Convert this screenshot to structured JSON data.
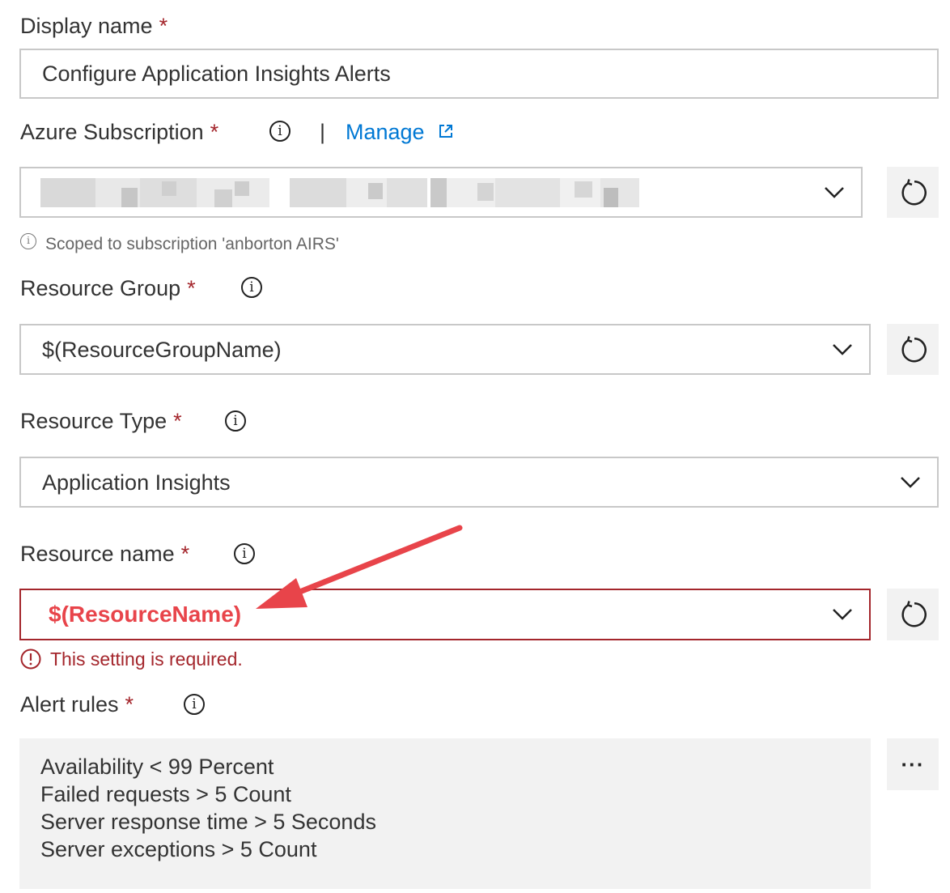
{
  "required_marker": "*",
  "info_glyph": "i",
  "display_name": {
    "label": "Display name",
    "value": "Configure Application Insights Alerts"
  },
  "azure_subscription": {
    "label": "Azure Subscription",
    "separator": "|",
    "manage_link": "Manage",
    "hint": "Scoped to subscription 'anborton AIRS'"
  },
  "resource_group": {
    "label": "Resource Group",
    "value": "$(ResourceGroupName)"
  },
  "resource_type": {
    "label": "Resource Type",
    "value": "Application Insights"
  },
  "resource_name": {
    "label": "Resource name",
    "value": "$(ResourceName)",
    "error": "This setting is required."
  },
  "alert_rules": {
    "label": "Alert rules",
    "rules": [
      "Availability < 99 Percent",
      "Failed requests > 5 Count",
      "Server response time > 5 Seconds",
      "Server exceptions > 5 Count"
    ],
    "more_glyph": "···"
  },
  "colors": {
    "required": "#a4262c",
    "link": "#0078d4",
    "annotation": "#e8444a",
    "field_border": "#c8c8c8",
    "error_border": "#a4262c"
  }
}
